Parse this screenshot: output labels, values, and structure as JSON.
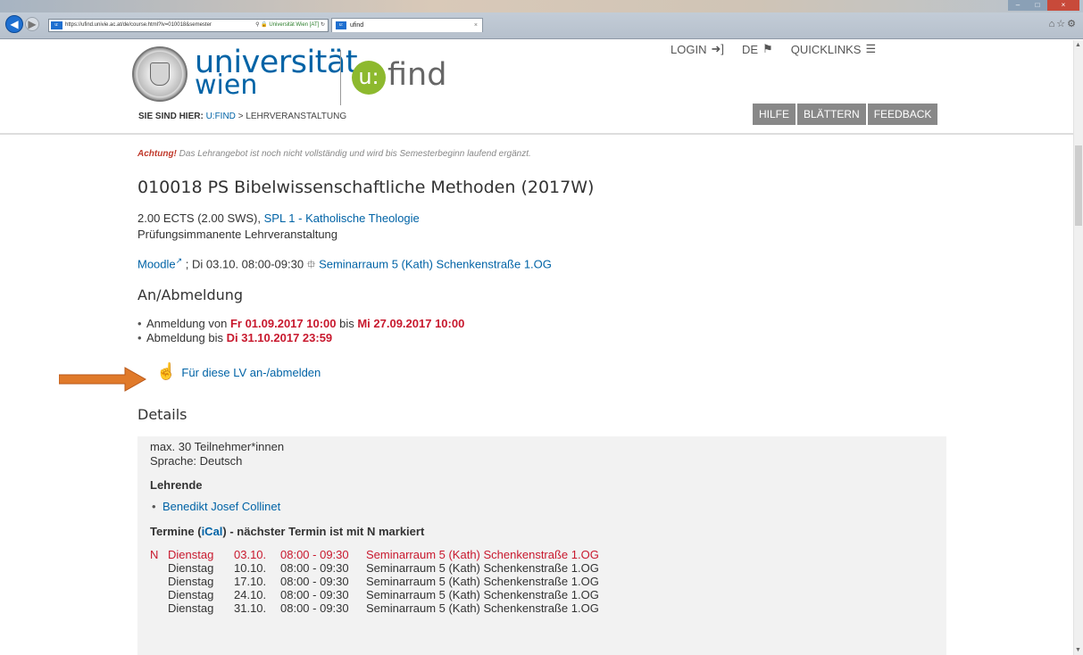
{
  "browser": {
    "address_url": "https://ufind.univie.ac.at/de/course.html?lv=010018&semester",
    "address_site": "Universität Wien [AT]",
    "tab_title": "ufind",
    "favicon_label": "u:",
    "tab_close": "×"
  },
  "header": {
    "brand_line1": "universität",
    "brand_line2": "wien",
    "ufind_circle": "u:",
    "ufind_text": "find",
    "login": "LOGIN",
    "language": "DE",
    "quicklinks": "QUICKLINKS",
    "breadcrumb_prefix": "SIE SIND HIER:",
    "breadcrumb_home": "U:FIND",
    "breadcrumb_sep": ">",
    "breadcrumb_current": "LEHRVERANSTALTUNG",
    "buttons": [
      "HILFE",
      "BLÄTTERN",
      "FEEDBACK"
    ]
  },
  "notice": {
    "warn": "Achtung!",
    "text": " Das Lehrangebot ist noch nicht vollständig und wird bis Semesterbeginn laufend ergänzt."
  },
  "course": {
    "title": "010018 PS Bibelwissenschaftliche Methoden (2017W)",
    "ects": "2.00 ECTS (2.00 SWS), ",
    "spl": "SPL 1 - Katholische Theologie",
    "type": "Prüfungsimmanente Lehrveranstaltung",
    "moodle": "Moodle",
    "session_text": " ; Di 03.10. 08:00-09:30 ",
    "room": "Seminarraum 5 (Kath) Schenkenstraße 1.OG"
  },
  "registration": {
    "heading": "An/Abmeldung",
    "anmeldung_prefix": "Anmeldung von ",
    "anmeldung_from": "Fr 01.09.2017 10:00",
    "anmeldung_mid": " bis ",
    "anmeldung_to": "Mi 27.09.2017 10:00",
    "abmeldung_prefix": "Abmeldung bis ",
    "abmeldung_to": "Di 31.10.2017 23:59",
    "register_link": "Für diese LV an-/abmelden"
  },
  "details": {
    "heading": "Details",
    "max_participants": "max. 30 Teilnehmer*innen",
    "language": "Sprache: Deutsch",
    "teachers_heading": "Lehrende",
    "teacher": "Benedikt Josef Collinet",
    "termine_prefix": "Termine (",
    "ical": "iCal",
    "termine_suffix": ") - nächster Termin ist mit N markiert",
    "sessions": [
      {
        "n": "N",
        "day": "Dienstag",
        "date": "03.10.",
        "time": "08:00 - 09:30",
        "room": "Seminarraum 5 (Kath) Schenkenstraße 1.OG"
      },
      {
        "n": "",
        "day": "Dienstag",
        "date": "10.10.",
        "time": "08:00 - 09:30",
        "room": "Seminarraum 5 (Kath) Schenkenstraße 1.OG"
      },
      {
        "n": "",
        "day": "Dienstag",
        "date": "17.10.",
        "time": "08:00 - 09:30",
        "room": "Seminarraum 5 (Kath) Schenkenstraße 1.OG"
      },
      {
        "n": "",
        "day": "Dienstag",
        "date": "24.10.",
        "time": "08:00 - 09:30",
        "room": "Seminarraum 5 (Kath) Schenkenstraße 1.OG"
      },
      {
        "n": "",
        "day": "Dienstag",
        "date": "31.10.",
        "time": "08:00 - 09:30",
        "room": "Seminarraum 5 (Kath) Schenkenstraße 1.OG"
      }
    ]
  },
  "colors": {
    "brand_blue": "#0063a6",
    "ufind_green": "#8db92e",
    "alert_red": "#c8192e",
    "annotation_arrow": "#e07a2a"
  }
}
